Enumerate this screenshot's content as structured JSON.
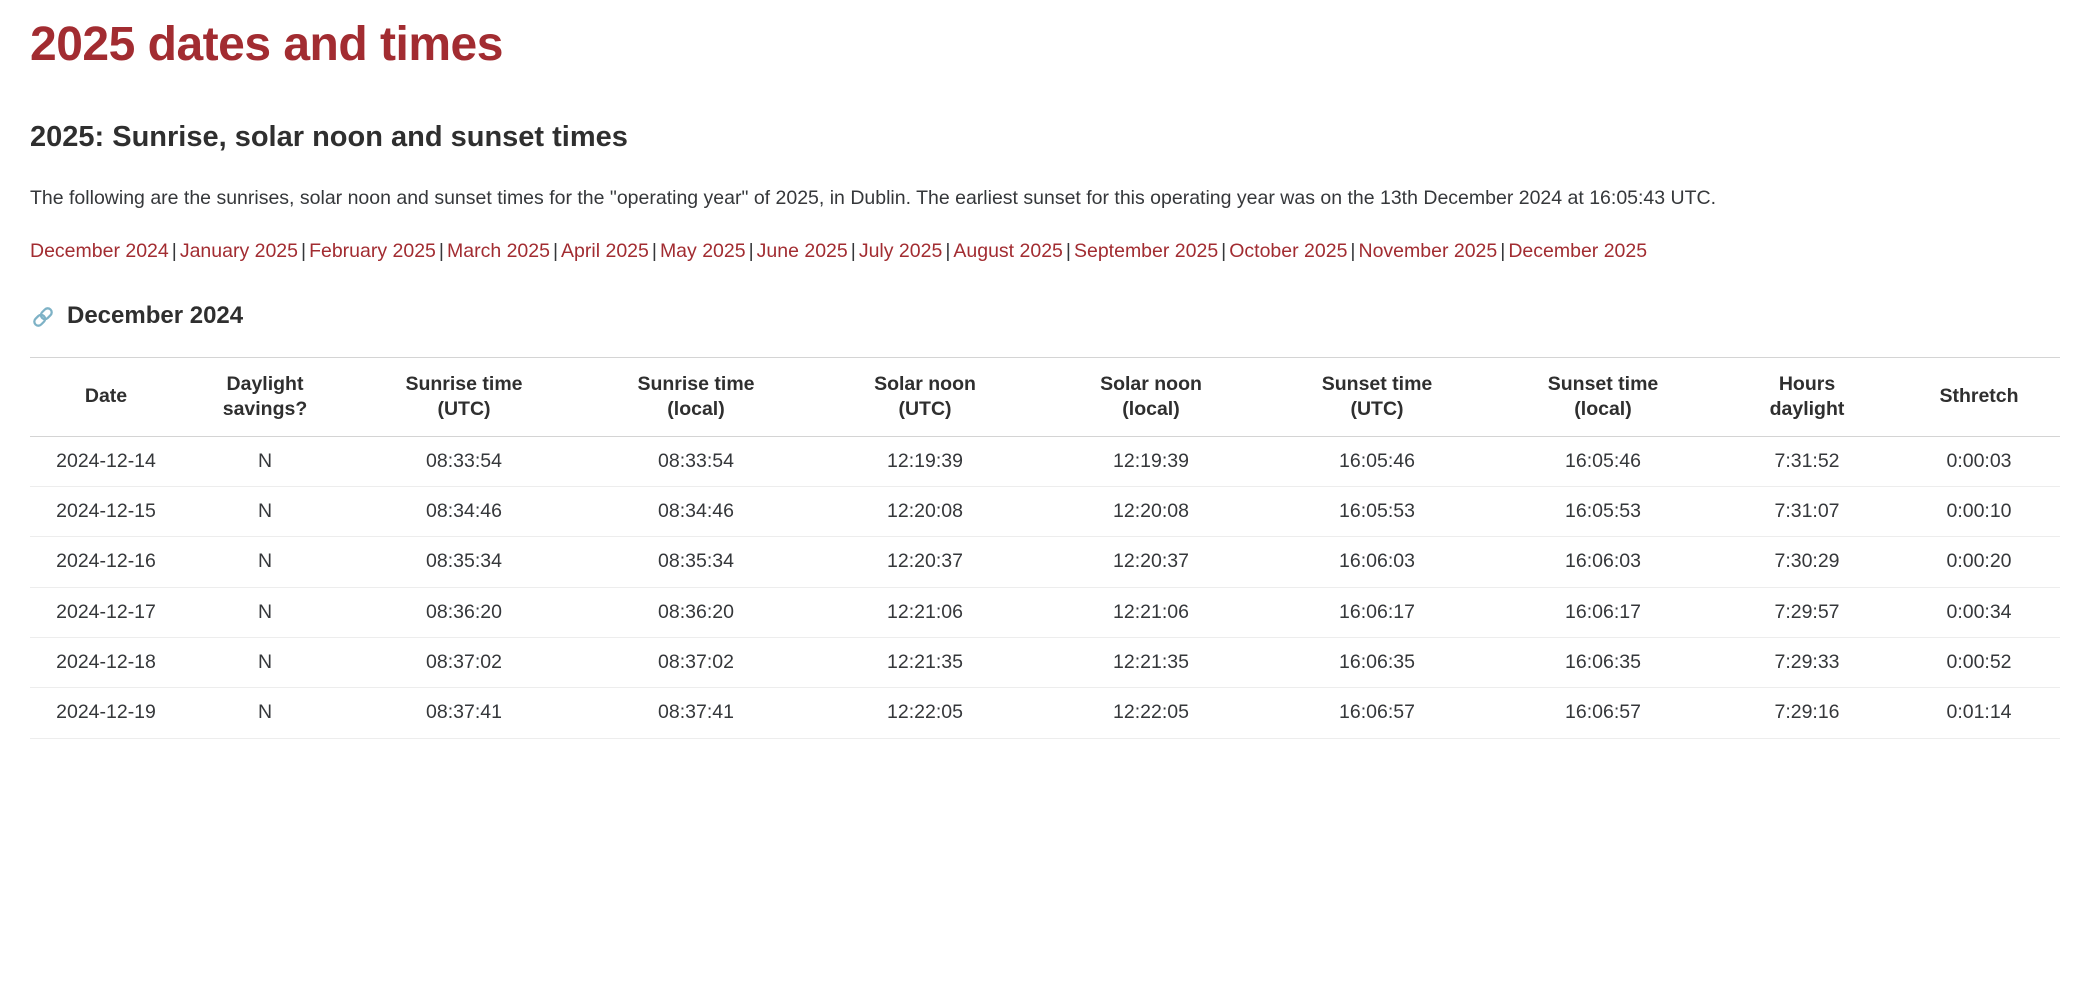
{
  "page": {
    "title": "2025 dates and times",
    "section_heading": "2025: Sunrise, solar noon and sunset times",
    "intro": "The following are the sunrises, solar noon and sunset times for the \"operating year\" of 2025, in Dublin. The earliest sunset for this operating year was on the 13th December 2024 at 16:05:43 UTC.",
    "accent_color": "#a22c31",
    "text_color": "#35373a",
    "link_icon_color": "#7eb2c6",
    "separator": "|"
  },
  "month_nav": {
    "icon": "anchor-link-icon",
    "links": [
      "December 2024",
      "January 2025",
      "February 2025",
      "March 2025",
      "April 2025",
      "May 2025",
      "June 2025",
      "July 2025",
      "August 2025",
      "September 2025",
      "October 2025",
      "November 2025",
      "December 2025"
    ]
  },
  "month_section": {
    "anchor_icon": "link-icon",
    "heading": "December 2024"
  },
  "table": {
    "columns": [
      {
        "line1": "Date",
        "line2": ""
      },
      {
        "line1": "Daylight",
        "line2": "savings?"
      },
      {
        "line1": "Sunrise time",
        "line2": "(UTC)"
      },
      {
        "line1": "Sunrise time",
        "line2": "(local)"
      },
      {
        "line1": "Solar noon",
        "line2": "(UTC)"
      },
      {
        "line1": "Solar noon",
        "line2": "(local)"
      },
      {
        "line1": "Sunset time",
        "line2": "(UTC)"
      },
      {
        "line1": "Sunset time",
        "line2": "(local)"
      },
      {
        "line1": "Hours",
        "line2": "daylight"
      },
      {
        "line1": "Sthretch",
        "line2": ""
      }
    ],
    "rows": [
      {
        "date": "2024-12-14",
        "daylight_savings": "N",
        "sunrise_utc": "08:33:54",
        "sunrise_local": "08:33:54",
        "solar_noon_utc": "12:19:39",
        "solar_noon_local": "12:19:39",
        "sunset_utc": "16:05:46",
        "sunset_local": "16:05:46",
        "hours_daylight": "7:31:52",
        "sthretch": "0:00:03"
      },
      {
        "date": "2024-12-15",
        "daylight_savings": "N",
        "sunrise_utc": "08:34:46",
        "sunrise_local": "08:34:46",
        "solar_noon_utc": "12:20:08",
        "solar_noon_local": "12:20:08",
        "sunset_utc": "16:05:53",
        "sunset_local": "16:05:53",
        "hours_daylight": "7:31:07",
        "sthretch": "0:00:10"
      },
      {
        "date": "2024-12-16",
        "daylight_savings": "N",
        "sunrise_utc": "08:35:34",
        "sunrise_local": "08:35:34",
        "solar_noon_utc": "12:20:37",
        "solar_noon_local": "12:20:37",
        "sunset_utc": "16:06:03",
        "sunset_local": "16:06:03",
        "hours_daylight": "7:30:29",
        "sthretch": "0:00:20"
      },
      {
        "date": "2024-12-17",
        "daylight_savings": "N",
        "sunrise_utc": "08:36:20",
        "sunrise_local": "08:36:20",
        "solar_noon_utc": "12:21:06",
        "solar_noon_local": "12:21:06",
        "sunset_utc": "16:06:17",
        "sunset_local": "16:06:17",
        "hours_daylight": "7:29:57",
        "sthretch": "0:00:34"
      },
      {
        "date": "2024-12-18",
        "daylight_savings": "N",
        "sunrise_utc": "08:37:02",
        "sunrise_local": "08:37:02",
        "solar_noon_utc": "12:21:35",
        "solar_noon_local": "12:21:35",
        "sunset_utc": "16:06:35",
        "sunset_local": "16:06:35",
        "hours_daylight": "7:29:33",
        "sthretch": "0:00:52"
      },
      {
        "date": "2024-12-19",
        "daylight_savings": "N",
        "sunrise_utc": "08:37:41",
        "sunrise_local": "08:37:41",
        "solar_noon_utc": "12:22:05",
        "solar_noon_local": "12:22:05",
        "sunset_utc": "16:06:57",
        "sunset_local": "16:06:57",
        "hours_daylight": "7:29:16",
        "sthretch": "0:01:14"
      }
    ]
  }
}
